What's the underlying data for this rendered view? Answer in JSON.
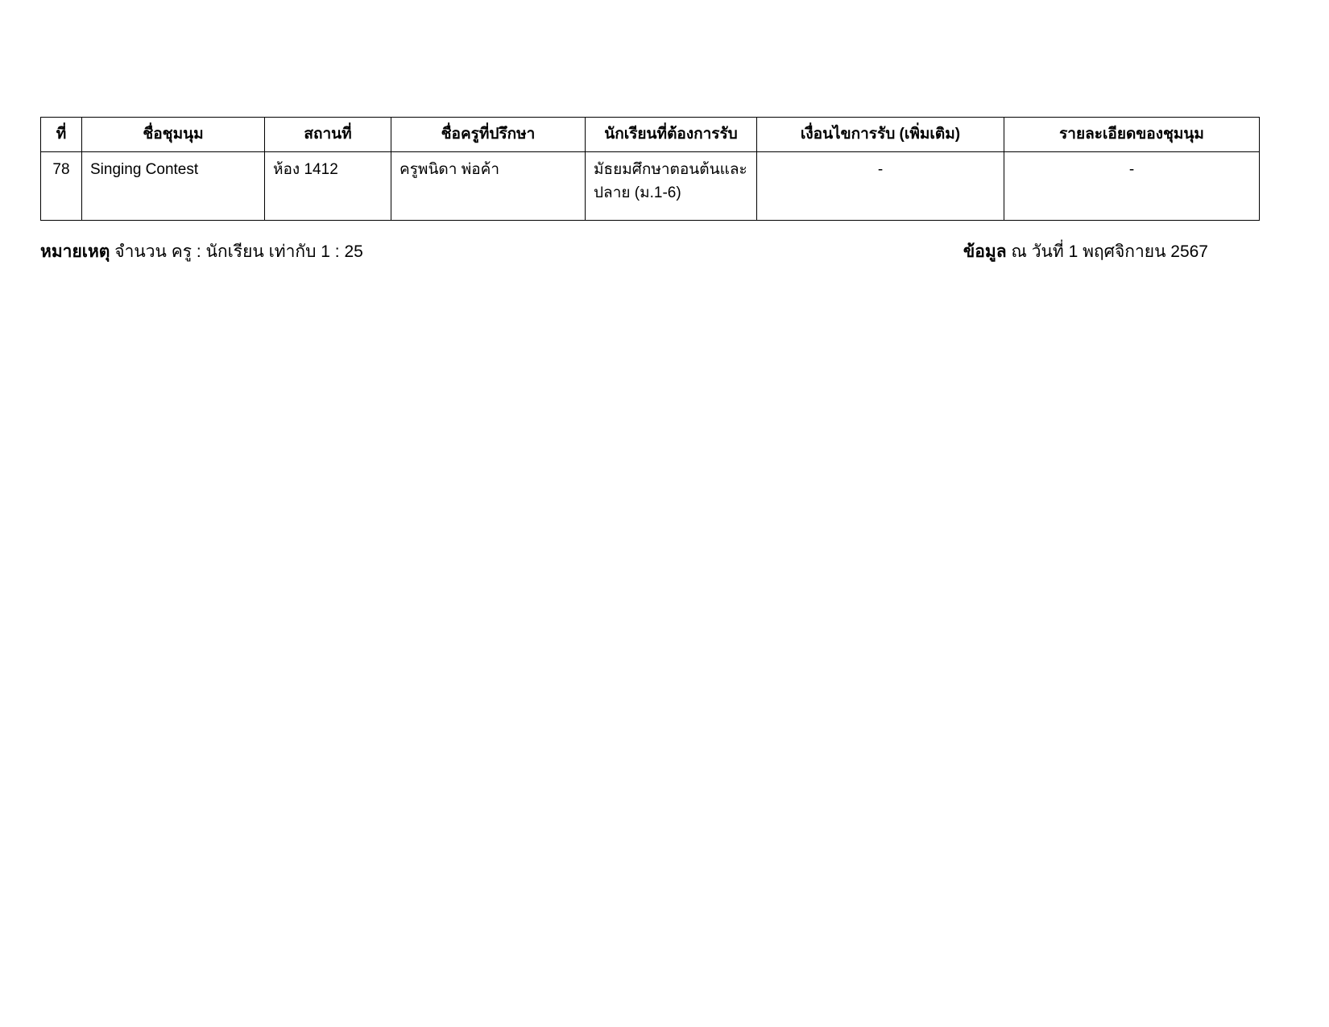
{
  "table": {
    "headers": [
      "ที่",
      "ชื่อชุมนุม",
      "สถานที่",
      "ชื่อครูที่ปรึกษา",
      "นักเรียนที่ต้องการรับ",
      "เงื่อนไขการรับ (เพิ่มเติม)",
      "รายละเอียดของชุมนุม"
    ],
    "rows": [
      {
        "no": "78",
        "club_name": "Singing Contest",
        "place": "ห้อง 1412",
        "teacher": "ครูพนิดา พ่อค้า",
        "student_level": "มัธยมศึกษาตอนต้นและปลาย (ม.1-6)",
        "conditions": "-",
        "details": "-"
      }
    ]
  },
  "footer": {
    "note_label": "หมายเหตุ",
    "note_text": "จำนวน ครู : นักเรียน เท่ากับ 1 : 25",
    "data_label": "ข้อมูล",
    "data_text": "ณ วันที่ 1 พฤศจิกายน 2567"
  },
  "colors": {
    "background": "#ffffff",
    "text": "#000000",
    "border": "#000000"
  }
}
